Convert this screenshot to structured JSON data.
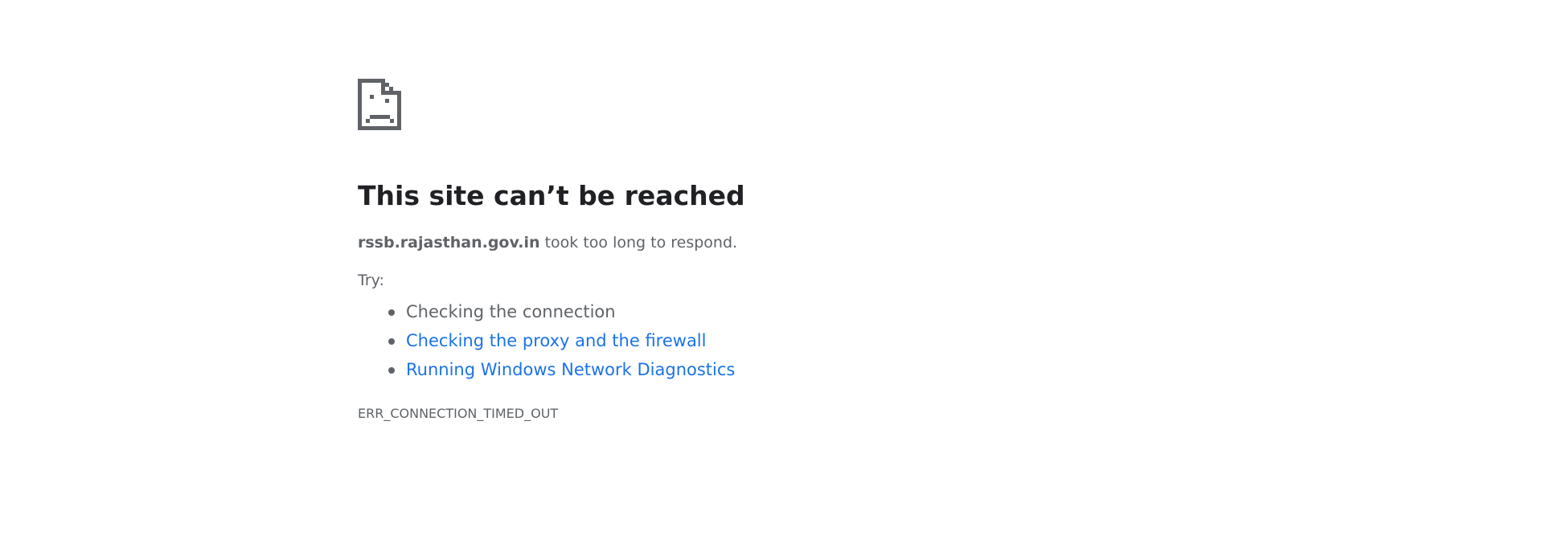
{
  "icon": "sad-page-icon",
  "headline": "This site can’t be reached",
  "summary": {
    "host": "rssb.rajasthan.gov.in",
    "message": " took too long to respond."
  },
  "try_label": "Try:",
  "suggestions": [
    {
      "label": "Checking the connection",
      "link": false
    },
    {
      "label": "Checking the proxy and the firewall",
      "link": true
    },
    {
      "label": "Running Windows Network Diagnostics",
      "link": true
    }
  ],
  "error_code": "ERR_CONNECTION_TIMED_OUT",
  "colors": {
    "text": "#5f6368",
    "heading": "#202124",
    "link": "#1a73e8",
    "icon": "#5f6368"
  }
}
